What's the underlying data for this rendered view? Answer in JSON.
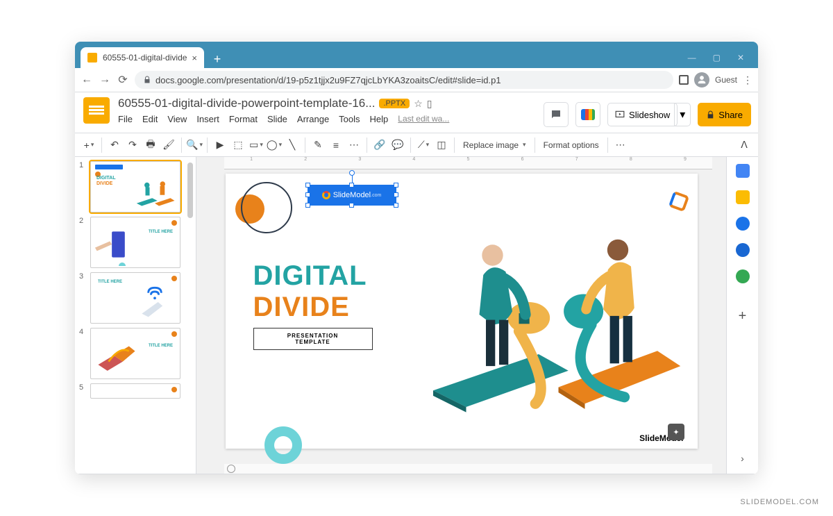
{
  "chrome": {
    "tab_title": "60555-01-digital-divide-powerpo",
    "url": "docs.google.com/presentation/d/19-p5z1tjjx2u9FZ7qjcLbYKA3zoaitsC/edit#slide=id.p1",
    "guest_label": "Guest"
  },
  "app": {
    "doc_title": "60555-01-digital-divide-powerpoint-template-16...",
    "badge": ".PPTX",
    "last_edit": "Last edit wa...",
    "slideshow": "Slideshow",
    "share": "Share"
  },
  "menus": {
    "file": "File",
    "edit": "Edit",
    "view": "View",
    "insert": "Insert",
    "format": "Format",
    "slide": "Slide",
    "arrange": "Arrange",
    "tools": "Tools",
    "help": "Help"
  },
  "toolbar": {
    "replace_image": "Replace image",
    "format_options": "Format options"
  },
  "slide": {
    "logo_text": "SlideModel",
    "h1a": "DIGITAL",
    "h1b": "DIVIDE",
    "sub1": "PRESENTATION",
    "sub2": "TEMPLATE",
    "footer": "SlideModel"
  },
  "thumbs": {
    "n1": "1",
    "n2": "2",
    "n3": "3",
    "n4": "4",
    "n5": "5",
    "t2_title": "TITLE HERE",
    "t3_title": "TITLE HERE",
    "t4_title": "TITLE HERE"
  },
  "watermark": "SLIDEMODEL.COM"
}
